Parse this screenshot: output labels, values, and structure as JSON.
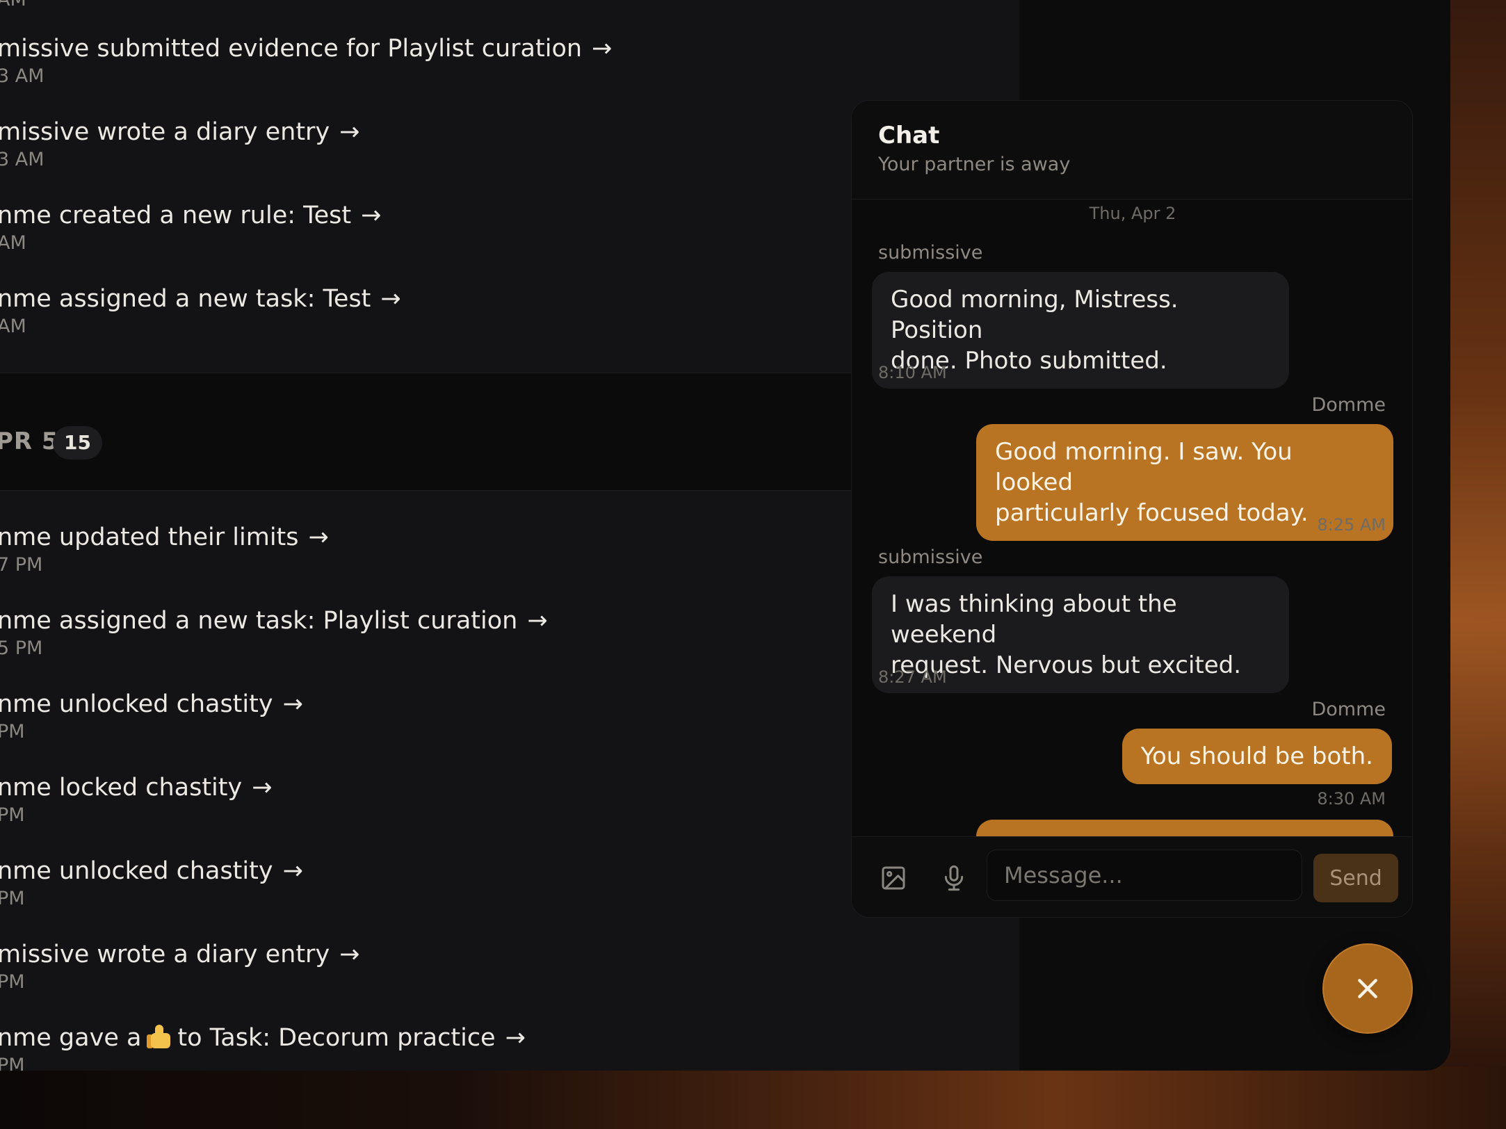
{
  "feed": {
    "items_top": [
      {
        "title": "missive submitted evidence for Playlist curation",
        "time": "3 AM"
      },
      {
        "title": "missive wrote a diary entry",
        "time": "3 AM"
      },
      {
        "title": "nme created a new rule: Test",
        "time": "AM"
      },
      {
        "title": "nme assigned a new task: Test",
        "time": "AM"
      }
    ],
    "day": {
      "label": "PR 5",
      "count": "15"
    },
    "items_bottom": [
      {
        "title": "nme updated their limits",
        "time": "7 PM"
      },
      {
        "title": "nme assigned a new task: Playlist curation",
        "time": "5 PM"
      },
      {
        "title": "nme unlocked chastity",
        "time": "PM"
      },
      {
        "title": "nme locked chastity",
        "time": "PM"
      },
      {
        "title": "nme unlocked chastity",
        "time": "PM"
      },
      {
        "title": "missive wrote a diary entry",
        "time": "PM"
      },
      {
        "title_before": "nme gave a",
        "title_after": "to Task: Decorum practice",
        "time": "PM"
      }
    ],
    "arrow": "→",
    "top_cut_time": "AM"
  },
  "chat": {
    "title": "Chat",
    "status": "Your partner is away",
    "date_separator": "Thu, Apr 2",
    "messages": [
      {
        "sender": "submissive",
        "line1": "Good morning, Mistress. Position",
        "line2": "done. Photo submitted.",
        "time": "8:10 AM",
        "direction": "in"
      },
      {
        "sender": "Domme",
        "line1": "Good morning. I saw. You looked",
        "line2": "particularly focused today.",
        "time": "8:25 AM",
        "direction": "out"
      },
      {
        "sender": "submissive",
        "line1": "I was thinking about the weekend",
        "line2": "request. Nervous but excited.",
        "time": "8:27 AM",
        "direction": "in"
      },
      {
        "sender": "Domme",
        "line1": "You should be both.",
        "time": "8:30 AM",
        "direction": "out"
      }
    ],
    "composer": {
      "placeholder": "Message...",
      "send_label": "Send",
      "image_icon": "image-icon",
      "mic_icon": "microphone-icon"
    }
  },
  "fab": {
    "icon": "close-icon"
  },
  "colors": {
    "accent": "#b87422",
    "background": "#131315",
    "panel": "#0b0b0c"
  }
}
